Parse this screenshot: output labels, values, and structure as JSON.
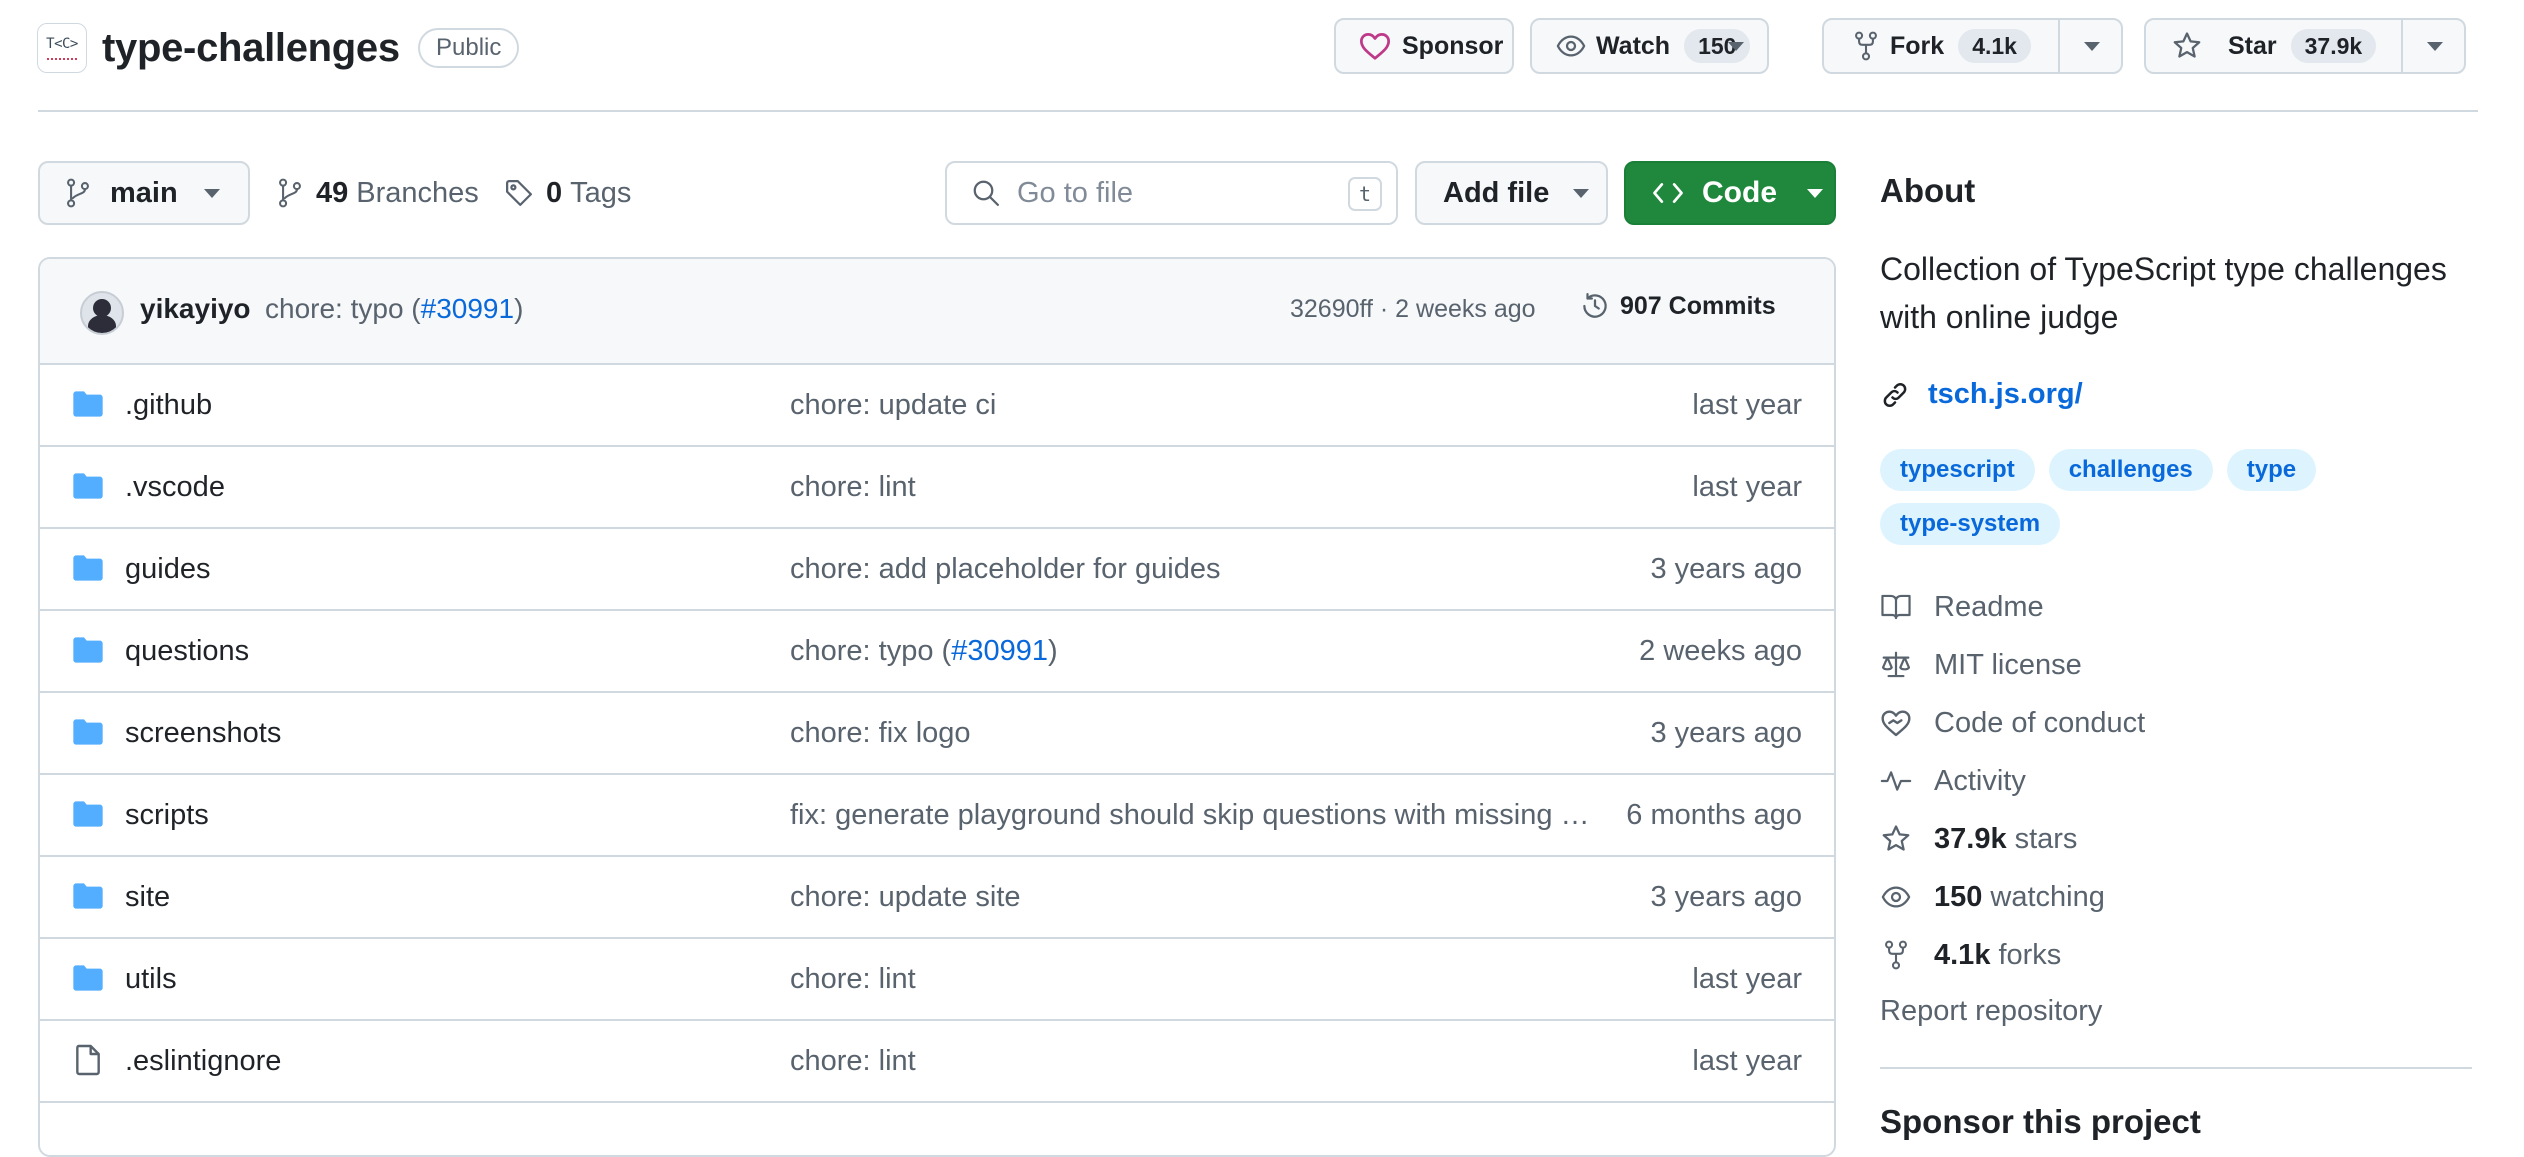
{
  "repo": {
    "logo_text": "T<C>",
    "name": "type-challenges",
    "visibility": "Public"
  },
  "header_actions": {
    "sponsor_label": "Sponsor",
    "watch_label": "Watch",
    "watch_count": "150",
    "fork_label": "Fork",
    "fork_count": "4.1k",
    "star_label": "Star",
    "star_count": "37.9k"
  },
  "toolbar": {
    "branch": "main",
    "branches_count": "49",
    "branches_label": "Branches",
    "tags_count": "0",
    "tags_label": "Tags",
    "goto_placeholder": "Go to file",
    "goto_shortcut": "t",
    "add_file_label": "Add file",
    "code_label": "Code"
  },
  "latest_commit": {
    "author": "yikayiyo",
    "message_prefix": "chore: typo (",
    "pr_link": "#30991",
    "message_suffix": ")",
    "meta": "32690ff · 2 weeks ago",
    "commits_count": "907 Commits"
  },
  "files": [
    {
      "type": "folder",
      "name": ".github",
      "message": "chore: update ci",
      "age": "last year"
    },
    {
      "type": "folder",
      "name": ".vscode",
      "message": "chore: lint",
      "age": "last year"
    },
    {
      "type": "folder",
      "name": "guides",
      "message": "chore: add placeholder for guides",
      "age": "3 years ago"
    },
    {
      "type": "folder",
      "name": "questions",
      "message_prefix": "chore: typo (",
      "message_link": "#30991",
      "message_suffix": ")",
      "age": "2 weeks ago"
    },
    {
      "type": "folder",
      "name": "screenshots",
      "message": "chore: fix logo",
      "age": "3 years ago"
    },
    {
      "type": "folder",
      "name": "scripts",
      "message": "fix: generate playground should skip questions with missing info",
      "age": "6 months ago"
    },
    {
      "type": "folder",
      "name": "site",
      "message": "chore: update site",
      "age": "3 years ago"
    },
    {
      "type": "folder",
      "name": "utils",
      "message": "chore: lint",
      "age": "last year"
    },
    {
      "type": "file",
      "name": ".eslintignore",
      "message": "chore: lint",
      "age": "last year"
    }
  ],
  "about": {
    "title": "About",
    "description": "Collection of TypeScript type challenges with online judge",
    "homepage": "tsch.js.org/",
    "topics": [
      "typescript",
      "challenges",
      "type",
      "type-system"
    ],
    "readme": "Readme",
    "license": "MIT license",
    "conduct": "Code of conduct",
    "activity": "Activity",
    "stars_count": "37.9k",
    "stars_label": "stars",
    "watching_count": "150",
    "watching_label": "watching",
    "forks_count": "4.1k",
    "forks_label": "forks",
    "report": "Report repository",
    "sponsor_title": "Sponsor this project"
  },
  "colors": {
    "accent_link": "#0969da",
    "code_button": "#1f883d",
    "folder_icon": "#54aeff",
    "sponsor_heart": "#bf3989"
  }
}
